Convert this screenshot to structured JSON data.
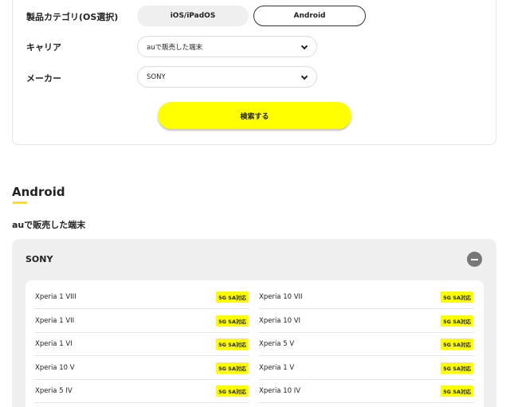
{
  "search": {
    "category_label": "製品カテゴリ(OS選択)",
    "os_options": [
      "iOS/iPadOS",
      "Android"
    ],
    "carrier_label": "キャリア",
    "carrier_value": "auで販売した端末",
    "maker_label": "メーカー",
    "maker_value": "SONY",
    "search_button": "検索する"
  },
  "results": {
    "section_title": "Android",
    "subheading": "auで販売した端末",
    "maker": "SONY",
    "badge": "5G SA対応",
    "devices_left": [
      "Xperia 1 VIII",
      "Xperia 1 VII",
      "Xperia 1 VI",
      "Xperia 10 V",
      "Xperia 5 IV"
    ],
    "devices_right": [
      "Xperia 10 VII",
      "Xperia 10 VI",
      "Xperia 5 V",
      "Xperia 1 V",
      "Xperia 10 IV"
    ]
  },
  "colors": {
    "accent_yellow": "#ffff00",
    "underline_yellow": "#ffe600",
    "panel_gray": "#efefef"
  }
}
